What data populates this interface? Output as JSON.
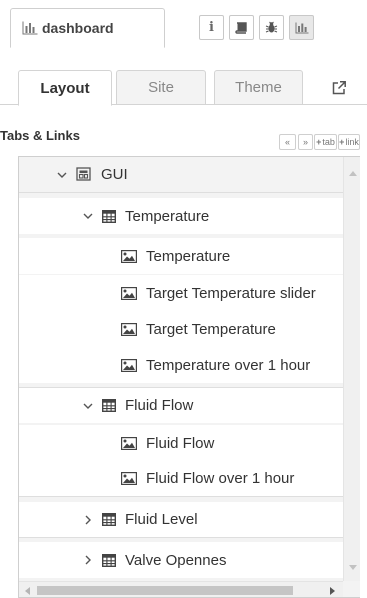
{
  "header": {
    "tab_label": "dashboard",
    "tab_icon": "bar-chart-icon",
    "tools": [
      {
        "name": "info",
        "icon": "info-icon",
        "glyph": "i"
      },
      {
        "name": "book",
        "icon": "book-icon"
      },
      {
        "name": "bug",
        "icon": "bug-icon"
      },
      {
        "name": "chart",
        "icon": "bar-chart-icon"
      }
    ]
  },
  "subtabs": {
    "layout": "Layout",
    "site": "Site",
    "theme": "Theme",
    "open_icon": "external-link-icon"
  },
  "section": {
    "title": "Tabs & Links",
    "buttons": {
      "collapse": "«",
      "expand": "»",
      "add_tab": "tab",
      "add_link": "link",
      "plus": "+"
    }
  },
  "tree": {
    "root": {
      "label": "GUI",
      "icon": "dashboard-tab-icon",
      "expanded": true
    },
    "groups": [
      {
        "label": "Temperature",
        "icon": "table-icon",
        "expanded": true,
        "widgets": [
          "Temperature",
          "Target Temperature slider",
          "Target Temperature",
          "Temperature over 1 hour"
        ]
      },
      {
        "label": "Fluid Flow",
        "icon": "table-icon",
        "expanded": true,
        "widgets": [
          "Fluid Flow",
          "Fluid Flow over 1 hour"
        ]
      },
      {
        "label": "Fluid Level",
        "icon": "table-icon",
        "expanded": false,
        "widgets": []
      },
      {
        "label": "Valve Opennes",
        "icon": "table-icon",
        "expanded": false,
        "widgets": []
      }
    ],
    "widget_icon": "image-icon"
  },
  "colors": {
    "panel_bg": "#f3f3f3",
    "border": "#cfcfcf",
    "text": "#333333"
  }
}
